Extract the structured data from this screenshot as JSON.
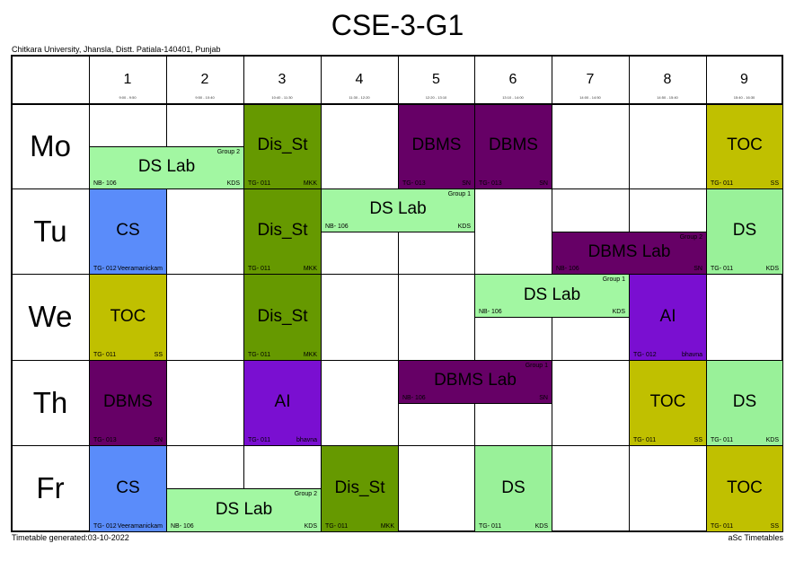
{
  "title": "CSE-3-G1",
  "subtitle": "Chitkara University, Jhansla, Distt. Patiala-140401, Punjab",
  "footer_left": "Timetable generated:03-10-2022",
  "footer_right": "aSc Timetables",
  "colors": {
    "dis_st": "#669900",
    "dbms": "#660066",
    "toc": "#c0c000",
    "ds_lab": "#a2f7a2",
    "cs": "#5a8cfa",
    "ai": "#7a0fd1",
    "ds": "#99f199"
  },
  "periods": [
    {
      "num": "1",
      "time": "9:00 - 9:50"
    },
    {
      "num": "2",
      "time": "9:50 - 10:40"
    },
    {
      "num": "3",
      "time": "10:40 - 11:30"
    },
    {
      "num": "4",
      "time": "11:30 - 12:20"
    },
    {
      "num": "5",
      "time": "12:20 - 13:10"
    },
    {
      "num": "6",
      "time": "13:10 - 14:00"
    },
    {
      "num": "7",
      "time": "14:00 - 14:50"
    },
    {
      "num": "8",
      "time": "14:50 - 15:40"
    },
    {
      "num": "9",
      "time": "15:40 - 16:30"
    }
  ],
  "days": [
    "Mo",
    "Tu",
    "We",
    "Th",
    "Fr"
  ],
  "lessons": [
    {
      "name": "lesson-mo-ds-lab",
      "subject": "DS Lab",
      "room": "NB- 106",
      "teacher": "KDS",
      "group": "Group 2"
    },
    {
      "name": "lesson-mo-dis-st",
      "subject": "Dis_St",
      "room": "TG- 011",
      "teacher": "MKK",
      "group": ""
    },
    {
      "name": "lesson-mo-dbms-5",
      "subject": "DBMS",
      "room": "TG- 013",
      "teacher": "SN",
      "group": ""
    },
    {
      "name": "lesson-mo-dbms-6",
      "subject": "DBMS",
      "room": "TG- 013",
      "teacher": "SN",
      "group": ""
    },
    {
      "name": "lesson-mo-toc",
      "subject": "TOC",
      "room": "TG- 011",
      "teacher": "SS",
      "group": ""
    },
    {
      "name": "lesson-tu-cs",
      "subject": "CS",
      "room": "TG- 012",
      "teacher": "Veeramanickam",
      "group": ""
    },
    {
      "name": "lesson-tu-dis-st",
      "subject": "Dis_St",
      "room": "TG- 011",
      "teacher": "MKK",
      "group": ""
    },
    {
      "name": "lesson-tu-ds-lab",
      "subject": "DS Lab",
      "room": "NB- 106",
      "teacher": "KDS",
      "group": "Group 1"
    },
    {
      "name": "lesson-tu-dbms-lab",
      "subject": "DBMS Lab",
      "room": "NB- 106",
      "teacher": "SN",
      "group": "Group 2"
    },
    {
      "name": "lesson-tu-ds",
      "subject": "DS",
      "room": "TG- 011",
      "teacher": "KDS",
      "group": ""
    },
    {
      "name": "lesson-we-toc",
      "subject": "TOC",
      "room": "TG- 011",
      "teacher": "SS",
      "group": ""
    },
    {
      "name": "lesson-we-dis-st",
      "subject": "Dis_St",
      "room": "TG- 011",
      "teacher": "MKK",
      "group": ""
    },
    {
      "name": "lesson-we-ds-lab",
      "subject": "DS Lab",
      "room": "NB- 106",
      "teacher": "KDS",
      "group": "Group 1"
    },
    {
      "name": "lesson-we-ai",
      "subject": "AI",
      "room": "TG- 012",
      "teacher": "bhavna",
      "group": ""
    },
    {
      "name": "lesson-th-dbms",
      "subject": "DBMS",
      "room": "TG- 013",
      "teacher": "SN",
      "group": ""
    },
    {
      "name": "lesson-th-ai",
      "subject": "AI",
      "room": "TG- 011",
      "teacher": "bhavna",
      "group": ""
    },
    {
      "name": "lesson-th-dbms-lab",
      "subject": "DBMS Lab",
      "room": "NB- 106",
      "teacher": "SN",
      "group": "Group 1"
    },
    {
      "name": "lesson-th-toc",
      "subject": "TOC",
      "room": "TG- 011",
      "teacher": "SS",
      "group": ""
    },
    {
      "name": "lesson-th-ds",
      "subject": "DS",
      "room": "TG- 011",
      "teacher": "KDS",
      "group": ""
    },
    {
      "name": "lesson-fr-cs",
      "subject": "CS",
      "room": "TG- 012",
      "teacher": "Veeramanickam",
      "group": ""
    },
    {
      "name": "lesson-fr-ds-lab",
      "subject": "DS Lab",
      "room": "NB- 106",
      "teacher": "KDS",
      "group": "Group 2"
    },
    {
      "name": "lesson-fr-dis-st",
      "subject": "Dis_St",
      "room": "TG- 011",
      "teacher": "MKK",
      "group": ""
    },
    {
      "name": "lesson-fr-ds",
      "subject": "DS",
      "room": "TG- 011",
      "teacher": "KDS",
      "group": ""
    },
    {
      "name": "lesson-fr-toc",
      "subject": "TOC",
      "room": "TG- 011",
      "teacher": "SS",
      "group": ""
    }
  ]
}
